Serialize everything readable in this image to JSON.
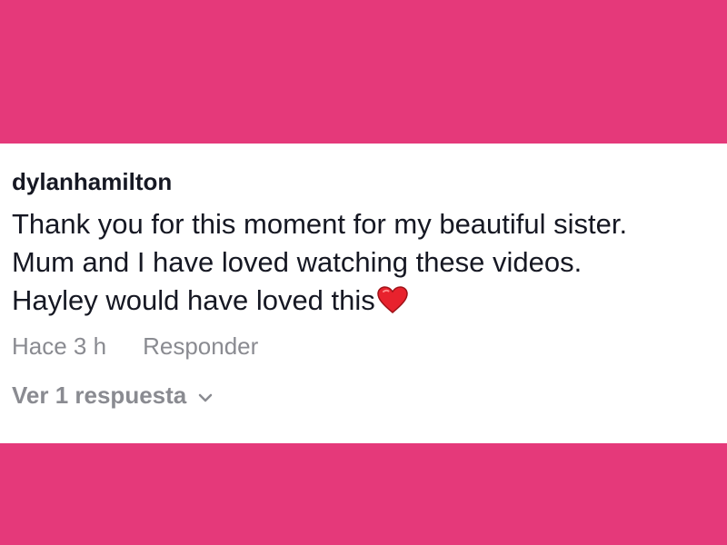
{
  "colors": {
    "background": "#e5397a",
    "card": "#ffffff",
    "text_primary": "#161823",
    "text_secondary": "#8a8b91",
    "heart": "#e8222d"
  },
  "comment": {
    "username": "dylanhamilton",
    "lines": [
      "Thank you for this moment for my beautiful sister.",
      "Mum and I have loved watching these videos.",
      "Hayley would have loved this"
    ],
    "emoji_icon": "red-heart-icon",
    "time_label": "Hace 3 h",
    "reply_label": "Responder",
    "view_replies_label": "Ver 1 respuesta",
    "view_replies_icon": "chevron-down-icon"
  }
}
